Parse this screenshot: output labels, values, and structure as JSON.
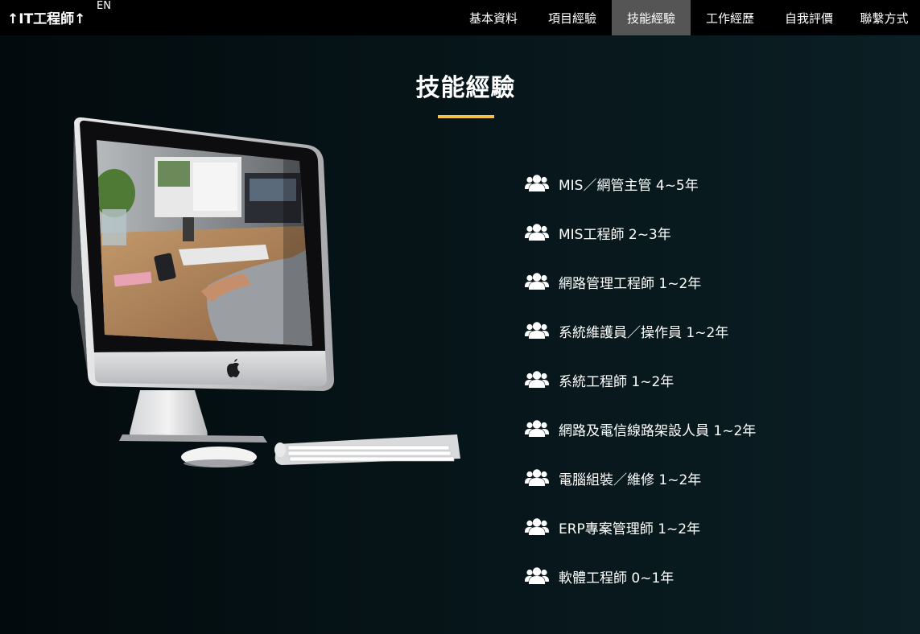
{
  "header": {
    "brand": "↑IT工程師↑",
    "lang_toggle": "EN",
    "nav": [
      {
        "label": "基本資料"
      },
      {
        "label": "項目經驗"
      },
      {
        "label": "技能經驗",
        "active": true
      },
      {
        "label": "工作經歷"
      },
      {
        "label": "自我評價"
      },
      {
        "label": "聯繫方式"
      }
    ]
  },
  "section": {
    "title": "技能經驗",
    "accent_color": "#f3c244"
  },
  "illustration": {
    "icon": "imac-desktop-computer"
  },
  "skills": [
    {
      "label": "MIS／網管主管 4~5年",
      "icon": "users-icon"
    },
    {
      "label": "MIS工程師 2~3年",
      "icon": "users-icon"
    },
    {
      "label": "網路管理工程師 1~2年",
      "icon": "users-icon"
    },
    {
      "label": "系統維護員／操作員 1~2年",
      "icon": "users-icon"
    },
    {
      "label": "系統工程師 1~2年",
      "icon": "users-icon"
    },
    {
      "label": "網路及電信線路架設人員 1~2年",
      "icon": "users-icon"
    },
    {
      "label": "電腦組裝／維修 1~2年",
      "icon": "users-icon"
    },
    {
      "label": "ERP專案管理師 1~2年",
      "icon": "users-icon"
    },
    {
      "label": "軟體工程師 0~1年",
      "icon": "users-icon"
    }
  ]
}
